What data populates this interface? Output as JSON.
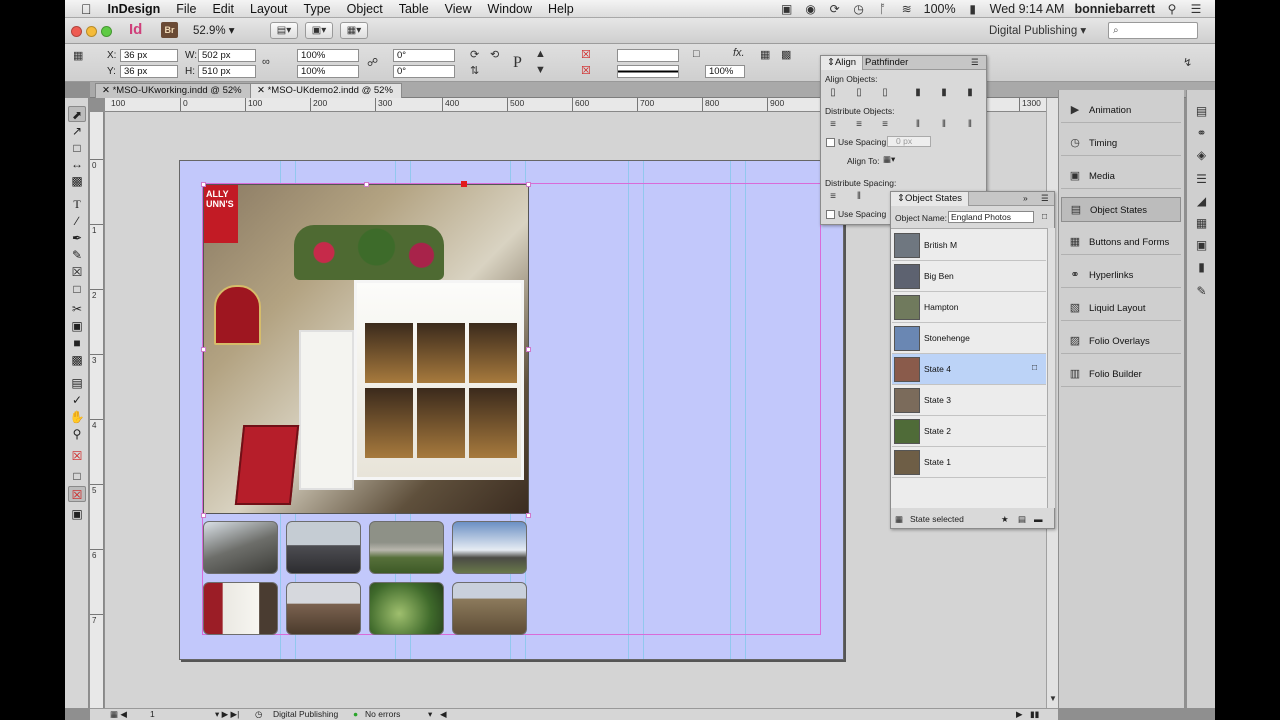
{
  "menubar": {
    "app": "InDesign",
    "items": [
      "File",
      "Edit",
      "Layout",
      "Type",
      "Object",
      "Table",
      "View",
      "Window",
      "Help"
    ],
    "battery": "100%",
    "clock": "Wed 9:14 AM",
    "user": "bonniebarrett"
  },
  "appbar": {
    "id_logo": "Id",
    "br_logo": "Br",
    "zoom": "52.9%",
    "workspace": "Digital Publishing",
    "search_placeholder": "⌕"
  },
  "control": {
    "x_label": "X:",
    "x_value": "36 px",
    "y_label": "Y:",
    "y_value": "36 px",
    "w_label": "W:",
    "w_value": "502 px",
    "h_label": "H:",
    "h_value": "510 px",
    "scale_x": "100%",
    "scale_y": "100%",
    "rotate": "0°",
    "shear": "0°",
    "opacity": "100%"
  },
  "tabs": [
    "*MSO-UKworking.indd @ 52%",
    "*MSO-UKdemo2.indd @ 52%"
  ],
  "ruler": {
    "h": [
      "100",
      "0",
      "100",
      "200",
      "300",
      "400",
      "500",
      "600",
      "700",
      "800",
      "900",
      "1300"
    ],
    "v": [
      "0",
      "1",
      "2",
      "3",
      "4",
      "5",
      "6",
      "7"
    ]
  },
  "photo": {
    "sign_text": "ALLY UNN'S"
  },
  "align_panel": {
    "tab_align": "Align",
    "tab_pathfinder": "Pathfinder",
    "align_objects": "Align Objects:",
    "distribute_objects": "Distribute Objects:",
    "use_spacing": "Use Spacing",
    "spacing_value": "0 px",
    "align_to": "Align To:",
    "distribute_spacing": "Distribute Spacing:",
    "use_spacing_2": "Use Spacing"
  },
  "object_states": {
    "title": "Object States",
    "object_name_label": "Object Name:",
    "object_name": "England Photos",
    "states": [
      {
        "name": "British M",
        "color": "#6f7780"
      },
      {
        "name": "Big Ben",
        "color": "#5d6270"
      },
      {
        "name": "Hampton",
        "color": "#707a5d"
      },
      {
        "name": "Stonehenge",
        "color": "#6a87b3"
      },
      {
        "name": "State 4",
        "color": "#8a5b4b"
      },
      {
        "name": "State 3",
        "color": "#7b6b5b"
      },
      {
        "name": "State 2",
        "color": "#4f6b38"
      },
      {
        "name": "State 1",
        "color": "#6e5e46"
      }
    ],
    "selected_index": 4,
    "footer": "State selected"
  },
  "dock": {
    "items": [
      {
        "label": "Animation",
        "icon": "▶"
      },
      {
        "label": "Timing",
        "icon": "◷"
      },
      {
        "label": "Media",
        "icon": "▣"
      },
      {
        "label": "Object States",
        "icon": "▤"
      },
      {
        "label": "Buttons and Forms",
        "icon": "▦"
      },
      {
        "label": "Hyperlinks",
        "icon": "⚭"
      },
      {
        "label": "Liquid Layout",
        "icon": "▧"
      },
      {
        "label": "Folio Overlays",
        "icon": "▨"
      },
      {
        "label": "Folio Builder",
        "icon": "▥"
      }
    ]
  },
  "status": {
    "page": "1",
    "profile": "Digital Publishing",
    "errors": "No errors"
  },
  "colors": {
    "page_fill": "#c2c8fb",
    "selection": "#bcd3f7",
    "frame_magenta": "#d96bd8"
  }
}
